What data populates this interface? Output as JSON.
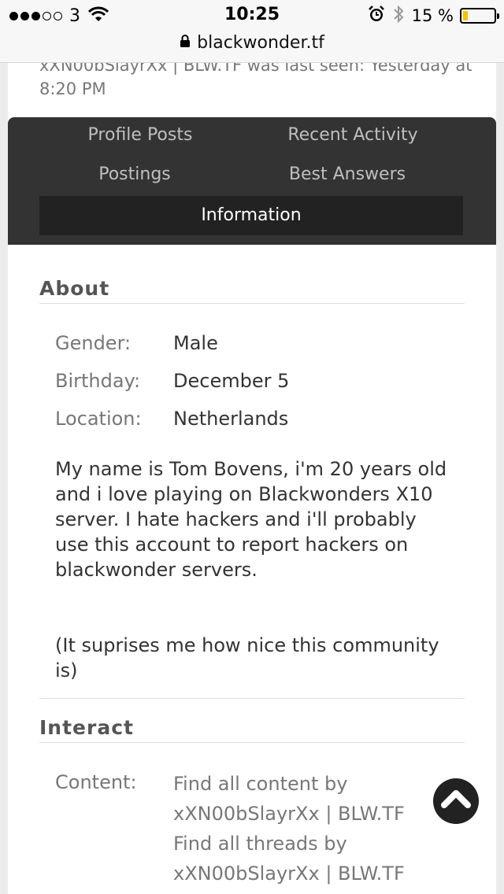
{
  "status_bar": {
    "signal_full": 3,
    "signal_empty": 2,
    "carrier": "3",
    "time": "10:25",
    "battery_percent": "15 %",
    "battery_level": 0.15,
    "icons": [
      "wifi-icon",
      "alarm-icon",
      "bluetooth-icon",
      "battery-icon"
    ]
  },
  "browser": {
    "url": "blackwonder.tf",
    "icon": "lock-icon"
  },
  "profile": {
    "last_seen_line1": "xXN00bSlayrXx | BLW.TF was last seen: Yesterday at",
    "last_seen_line2": "8:20 PM"
  },
  "tabs": [
    {
      "label": "Profile Posts"
    },
    {
      "label": "Recent Activity"
    },
    {
      "label": "Postings"
    },
    {
      "label": "Best Answers"
    },
    {
      "label": "Information",
      "active": true
    }
  ],
  "about": {
    "title": "About",
    "rows": [
      {
        "label": "Gender:",
        "value": "Male"
      },
      {
        "label": "Birthday:",
        "value": "December 5"
      },
      {
        "label": "Location:",
        "value": "Netherlands"
      }
    ],
    "bio_line1": "My name is Tom Bovens, i'm 20 years old",
    "bio_line2": "and i love playing on Blackwonders X10",
    "bio_line3": "server. I hate hackers and i'll probably",
    "bio_line4": "use this account to report hackers on",
    "bio_line5": "blackwonder servers.",
    "note_line1": "(It suprises me how nice this community",
    "note_line2": "is)"
  },
  "interact": {
    "title": "Interact",
    "content_label": "Content:",
    "link1_line1": "Find all content by",
    "link1_line2": "xXN00bSlayrXx | BLW.TF",
    "link2_line1": "Find all threads by",
    "link2_line2": "xXN00bSlayrXx | BLW.TF"
  },
  "colors": {
    "tab_bar": "#333333",
    "tab_active": "#222222",
    "battery_fill": "#f5c400"
  }
}
